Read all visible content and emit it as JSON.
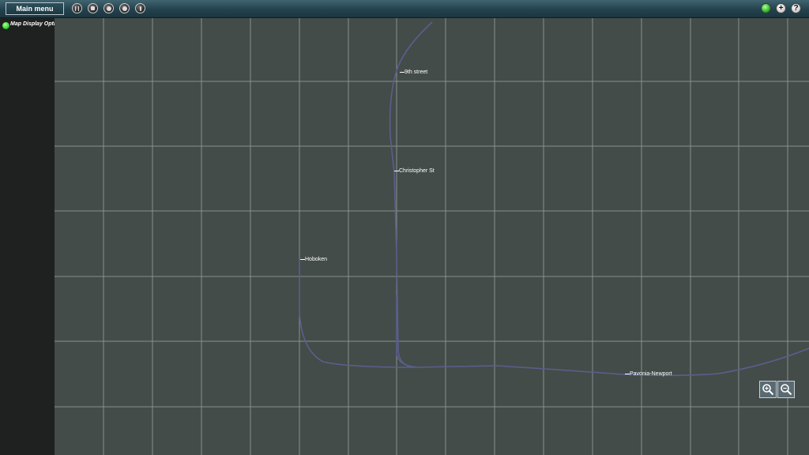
{
  "toolbar": {
    "main_menu_label": "Main menu",
    "buttons": [
      {
        "icon": "pause-icon"
      },
      {
        "icon": "stop-icon"
      },
      {
        "icon": "record-icon"
      },
      {
        "icon": "target-icon"
      },
      {
        "icon": "info-icon"
      }
    ],
    "right": [
      {
        "icon": "status-light-icon"
      },
      {
        "icon": "add-icon",
        "glyph": "+"
      },
      {
        "icon": "help-icon",
        "glyph": "?"
      }
    ]
  },
  "sidebar": {
    "option_label": "Map Display Options"
  },
  "map": {
    "stations": {
      "ninth": "9th street",
      "christopher": "Christopher St",
      "hoboken": "Hoboken",
      "pavonia": "Pavonia-Newport"
    },
    "track_color": "#5a5f8c",
    "grid_color": "#8a9496"
  },
  "zoom": {
    "in_icon": "zoom-in-icon",
    "out_icon": "zoom-out-icon"
  }
}
